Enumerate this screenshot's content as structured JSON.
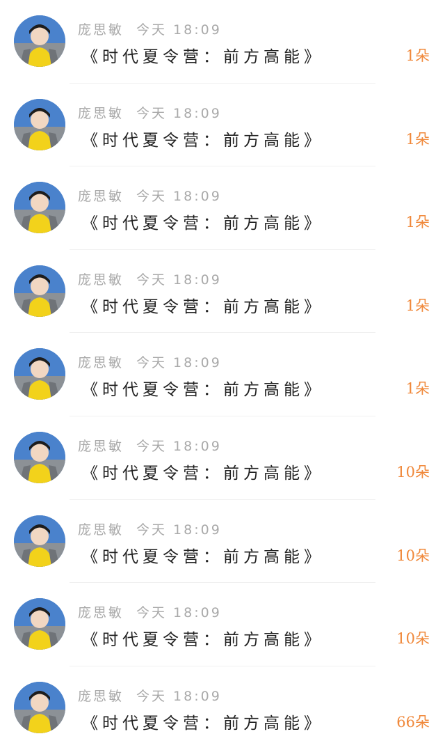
{
  "records": [
    {
      "name": "庞思敏",
      "time": "今天 18:09",
      "title": "《时代夏令营：前方高能》",
      "count": "1朵"
    },
    {
      "name": "庞思敏",
      "time": "今天 18:09",
      "title": "《时代夏令营：前方高能》",
      "count": "1朵"
    },
    {
      "name": "庞思敏",
      "time": "今天 18:09",
      "title": "《时代夏令营：前方高能》",
      "count": "1朵"
    },
    {
      "name": "庞思敏",
      "time": "今天 18:09",
      "title": "《时代夏令营：前方高能》",
      "count": "1朵"
    },
    {
      "name": "庞思敏",
      "time": "今天 18:09",
      "title": "《时代夏令营：前方高能》",
      "count": "1朵"
    },
    {
      "name": "庞思敏",
      "time": "今天 18:09",
      "title": "《时代夏令营：前方高能》",
      "count": "10朵"
    },
    {
      "name": "庞思敏",
      "time": "今天 18:09",
      "title": "《时代夏令营：前方高能》",
      "count": "10朵"
    },
    {
      "name": "庞思敏",
      "time": "今天 18:09",
      "title": "《时代夏令营：前方高能》",
      "count": "10朵"
    },
    {
      "name": "庞思敏",
      "time": "今天 18:09",
      "title": "《时代夏令营：前方高能》",
      "count": "66朵"
    }
  ],
  "colors": {
    "count_accent": "#f0883a",
    "meta_text": "#a9a9a9",
    "title_text": "#222222"
  }
}
